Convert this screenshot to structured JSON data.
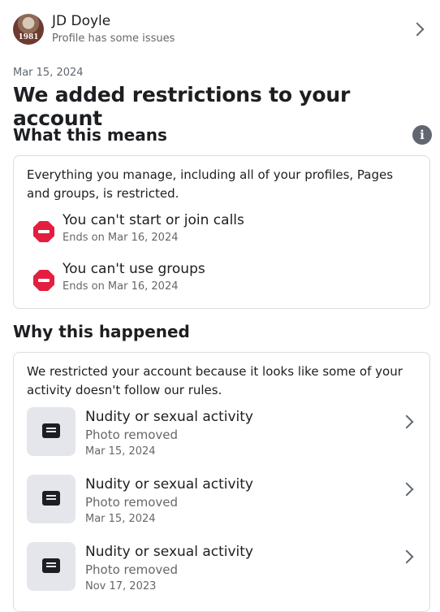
{
  "profile": {
    "name": "JD Doyle",
    "status": "Profile has some issues",
    "avatar_year": "1981"
  },
  "notice": {
    "date": "Mar 15, 2024",
    "title": "We added restrictions to your account"
  },
  "what_this_means": {
    "title": "What this means",
    "description": "Everything you manage, including all of your profiles, Pages and groups, is restricted.",
    "restrictions": [
      {
        "title": "You can't start or join calls",
        "ends": "Ends on Mar 16, 2024"
      },
      {
        "title": "You can't use groups",
        "ends": "Ends on Mar 16, 2024"
      }
    ]
  },
  "why_this_happened": {
    "title": "Why this happened",
    "description": "We restricted your account because it looks like some of your activity doesn't follow our rules.",
    "reasons": [
      {
        "title": "Nudity or sexual activity",
        "action": "Photo removed",
        "date": "Mar 15, 2024"
      },
      {
        "title": "Nudity or sexual activity",
        "action": "Photo removed",
        "date": "Mar 15, 2024"
      },
      {
        "title": "Nudity or sexual activity",
        "action": "Photo removed",
        "date": "Nov 17, 2023"
      }
    ]
  },
  "colors": {
    "stop_icon": "#e41e3f",
    "muted_text": "#65676b",
    "border": "#dadde1",
    "icon_bg": "#e4e6eb"
  },
  "icons": {
    "info": "info-icon",
    "restriction": "stop-icon",
    "reason": "document-icon",
    "chevron": "chevron-right-icon"
  }
}
